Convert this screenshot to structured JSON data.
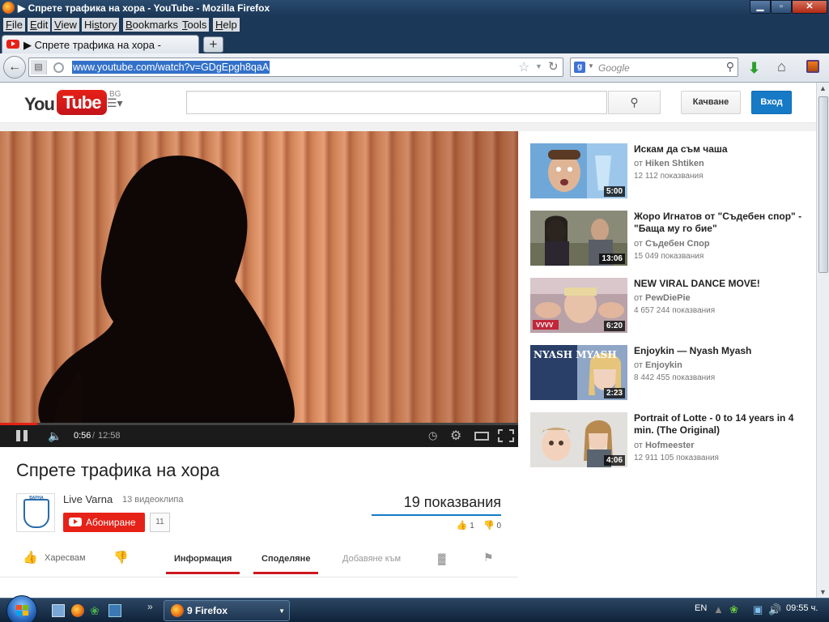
{
  "window": {
    "title": "▶ Спрете трафика на хора - YouTube - Mozilla Firefox",
    "min_label": "▁",
    "max_label": "▫",
    "close_label": "✕"
  },
  "menu": {
    "items": [
      {
        "prefix": "",
        "key": "F",
        "rest": "ile"
      },
      {
        "prefix": "",
        "key": "E",
        "rest": "dit"
      },
      {
        "prefix": "",
        "key": "V",
        "rest": "iew"
      },
      {
        "prefix": "Hi",
        "key": "s",
        "rest": "tory"
      },
      {
        "prefix": "",
        "key": "B",
        "rest": "ookmarks"
      },
      {
        "prefix": "",
        "key": "T",
        "rest": "ools"
      },
      {
        "prefix": "",
        "key": "H",
        "rest": "elp"
      }
    ]
  },
  "tab": {
    "title": "▶ Спрете трафика на хора - YouTube",
    "new_tab_label": "+"
  },
  "nav": {
    "url": "www.youtube.com/watch?v=GDgEpgh8qaA",
    "search_placeholder": "Google",
    "search_engine_letter": "g"
  },
  "youtube": {
    "logo_you": "You",
    "logo_tube": "Tube",
    "country": "BG",
    "upload_label": "Качване",
    "signin_label": "Вход"
  },
  "player": {
    "time_current": "0:56",
    "time_separator": "/",
    "time_total": "12:58",
    "progress": 0.072
  },
  "video": {
    "title": "Спрете трафика на хора",
    "channel": "Live Varna",
    "video_count": "13 видеоклипа",
    "subscribe_label": "Абониране",
    "subscriber_count": "11",
    "views": "19 показвания",
    "likes": "1",
    "dislikes": "0",
    "crest_text": "ВАРНА"
  },
  "actions": {
    "like_label": "Харесвам",
    "tabs": [
      "Информация",
      "Споделяне",
      "Добавяне към"
    ]
  },
  "related": [
    {
      "title": "Искам да съм чаша",
      "channel_prefix": "от",
      "channel": "Hiken Shtiken",
      "views": "12 112 показвания",
      "duration": "5:00"
    },
    {
      "title": "Жоро Игнатов от \"Съдебен спор\" - \"Баща му го бие\"",
      "channel_prefix": "от",
      "channel": "Съдебен Спор",
      "views": "15 049 показвания",
      "duration": "13:06"
    },
    {
      "title": "NEW VIRAL DANCE MOVE!",
      "channel_prefix": "от",
      "channel": "PewDiePie",
      "views": "4 657 244 показвания",
      "duration": "6:20",
      "thumb_caption": "VVVV"
    },
    {
      "title": "Enjoykin — Nyash Myash",
      "channel_prefix": "от",
      "channel": "Enjoykin",
      "views": "8 442 455 показвания",
      "duration": "2:23",
      "thumb_caption": "NYASH MYASH"
    },
    {
      "title": "Portrait of Lotte - 0 to 14 years in 4 min. (The Original)",
      "channel_prefix": "от",
      "channel": "Hofmeester",
      "views": "12 911 105 показвания",
      "duration": "4:06"
    }
  ],
  "taskbar": {
    "more": "»",
    "task_label": "9 Firefox",
    "language": "EN",
    "clock": "09:55 ч."
  },
  "colors": {
    "youtube_red": "#e62117",
    "signin_blue": "#167ac6",
    "active_tab_underline": "#cc181e"
  }
}
